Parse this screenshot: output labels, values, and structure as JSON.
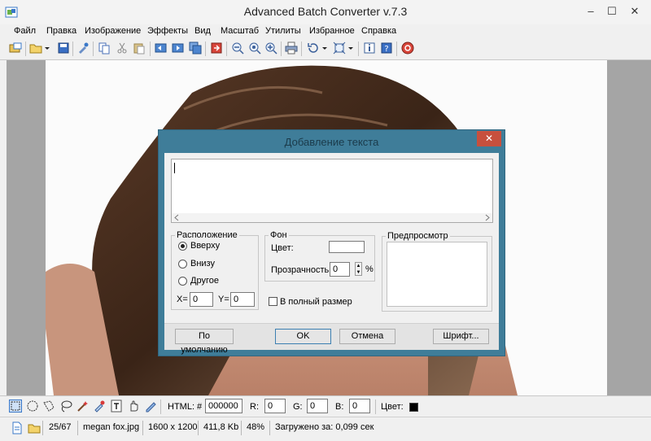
{
  "window": {
    "title": "Advanced Batch Converter v.7.3",
    "minimize": "‒",
    "maximize": "☐",
    "close": "✕"
  },
  "menu": [
    "Файл",
    "Правка",
    "Изображение",
    "Эффекты",
    "Вид",
    "Масштаб",
    "Утилиты",
    "Избранное",
    "Справка"
  ],
  "bottom_toolbar": {
    "html_label": "HTML: #",
    "html_value": "000000",
    "r_label": "R:",
    "r_value": "0",
    "g_label": "G:",
    "g_value": "0",
    "b_label": "B:",
    "b_value": "0",
    "color_label": "Цвет:",
    "color_swatch": "#000000"
  },
  "status": {
    "counter": "25/67",
    "filename": "megan fox.jpg",
    "dimensions": "1600 x 1200",
    "filesize": "411,8 Kb",
    "zoom": "48%",
    "loaded": "Загружено за: 0,099 сек"
  },
  "dialog": {
    "title": "Добавление текста",
    "close": "✕",
    "text_value": "",
    "position_group": {
      "title": "Расположение",
      "options": [
        "Вверху",
        "Внизу",
        "Другое"
      ],
      "selected": "Вверху",
      "x_label": "X=",
      "x_value": "0",
      "y_label": "Y=",
      "y_value": "0"
    },
    "background_group": {
      "title": "Фон",
      "color_label": "Цвет:",
      "transparency_label": "Прозрачность:",
      "transparency_value": "0",
      "percent": "%"
    },
    "fullsize_label": "В полный размер",
    "preview_title": "Предпросмотр",
    "buttons": {
      "default": "По умолчанию",
      "ok": "OK",
      "cancel": "Отмена",
      "font": "Шрифт..."
    }
  },
  "colors": {
    "dialog_frame": "#3f7d99",
    "close_red": "#c7503e",
    "canvas_gray": "#a5a5a5"
  }
}
